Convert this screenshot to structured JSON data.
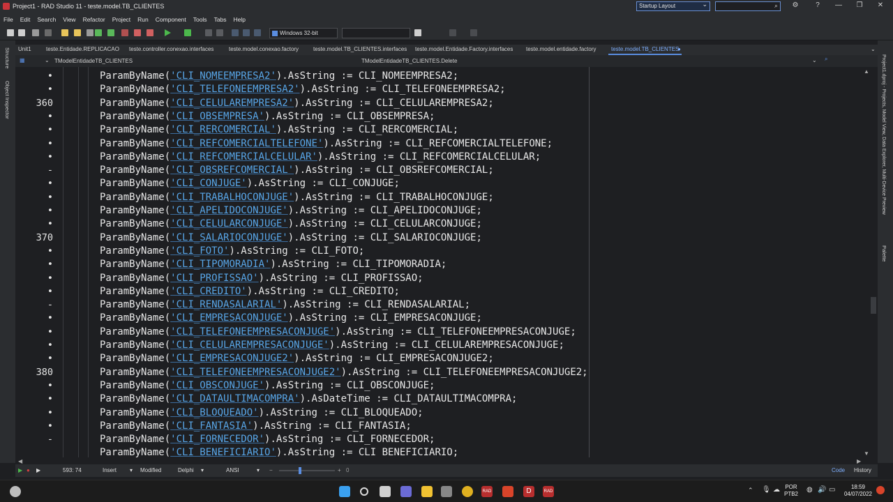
{
  "window": {
    "title": "Project1 - RAD Studio 11 - teste.model.TB_CLIENTES",
    "layout": "Startup Layout",
    "help": "?"
  },
  "menu": [
    "File",
    "Edit",
    "Search",
    "View",
    "Refactor",
    "Project",
    "Run",
    "Component",
    "Tools",
    "Tabs",
    "Help"
  ],
  "toolbar": {
    "platform": "Windows 32-bit",
    "config": ""
  },
  "left_rail": {
    "structure": "Structure",
    "object_inspector": "Object Inspector"
  },
  "right_rail": {
    "projects": "Project1.dproj - Projects, Model View, Data Explorer, Multi-Device Preview",
    "palette": "Palette"
  },
  "tabs": [
    "Unit1",
    "teste.Entidade.REPLICACAO",
    "teste.controller.conexao.interfaces",
    "teste.model.conexao.factory",
    "teste.model.TB_CLIENTES.interfaces",
    "teste.model.Entidade.Factory.interfaces",
    "teste.model.entidade.factory",
    "teste.model.TB_CLIENTES"
  ],
  "navbar": {
    "class": "TModelEntidadeTB_CLIENTES",
    "method": "TModelEntidadeTB_CLIENTES.Delete"
  },
  "editor": {
    "line_markers": [
      "•",
      "•",
      "360",
      "•",
      "•",
      "•",
      "•",
      "-",
      "•",
      "•",
      "•",
      "•",
      "370",
      "•",
      "•",
      "•",
      "•",
      "-",
      "•",
      "•",
      "•",
      "•",
      "380",
      "•",
      "•",
      "•",
      "•",
      "-"
    ],
    "lines": [
      {
        "pre": "ParamByName(",
        "str": "'CLI_NOMEEMPRESA2'",
        "post": ").AsString := CLI_NOMEEMPRESA2;"
      },
      {
        "pre": "ParamByName(",
        "str": "'CLI_TELEFONEEMPRESA2'",
        "post": ").AsString := CLI_TELEFONEEMPRESA2;"
      },
      {
        "pre": "ParamByName(",
        "str": "'CLI_CELULAREMPRESA2'",
        "post": ").AsString := CLI_CELULAREMPRESA2;"
      },
      {
        "pre": "ParamByName(",
        "str": "'CLI_OBSEMPRESA'",
        "post": ").AsString := CLI_OBSEMPRESA;"
      },
      {
        "pre": "ParamByName(",
        "str": "'CLI_RERCOMERCIAL'",
        "post": ").AsString := CLI_RERCOMERCIAL;"
      },
      {
        "pre": "ParamByName(",
        "str": "'CLI_REFCOMERCIALTELEFONE'",
        "post": ").AsString := CLI_REFCOMERCIALTELEFONE;"
      },
      {
        "pre": "ParamByName(",
        "str": "'CLI_REFCOMERCIALCELULAR'",
        "post": ").AsString := CLI_REFCOMERCIALCELULAR;"
      },
      {
        "pre": "ParamByName(",
        "str": "'CLI_OBSREFCOMERCIAL'",
        "post": ").AsString := CLI_OBSREFCOMERCIAL;"
      },
      {
        "pre": "ParamByName(",
        "str": "'CLI_CONJUGE'",
        "post": ").AsString := CLI_CONJUGE;"
      },
      {
        "pre": "ParamByName(",
        "str": "'CLI_TRABALHOCONJUGE'",
        "post": ").AsString := CLI_TRABALHOCONJUGE;"
      },
      {
        "pre": "ParamByName(",
        "str": "'CLI_APELIDOCONJUGE'",
        "post": ").AsString := CLI_APELIDOCONJUGE;"
      },
      {
        "pre": "ParamByName(",
        "str": "'CLI_CELULARCONJUGE'",
        "post": ").AsString := CLI_CELULARCONJUGE;"
      },
      {
        "pre": "ParamByName(",
        "str": "'CLI_SALARIOCONJUGE'",
        "post": ").AsString := CLI_SALARIOCONJUGE;"
      },
      {
        "pre": "ParamByName(",
        "str": "'CLI_FOTO'",
        "post": ").AsString := CLI_FOTO;"
      },
      {
        "pre": "ParamByName(",
        "str": "'CLI_TIPOMORADIA'",
        "post": ").AsString := CLI_TIPOMORADIA;"
      },
      {
        "pre": "ParamByName(",
        "str": "'CLI_PROFISSAO'",
        "post": ").AsString := CLI_PROFISSAO;"
      },
      {
        "pre": "ParamByName(",
        "str": "'CLI_CREDITO'",
        "post": ").AsString := CLI_CREDITO;"
      },
      {
        "pre": "ParamByName(",
        "str": "'CLI_RENDASALARIAL'",
        "post": ").AsString := CLI_RENDASALARIAL;"
      },
      {
        "pre": "ParamByName(",
        "str": "'CLI_EMPRESACONJUGE'",
        "post": ").AsString := CLI_EMPRESACONJUGE;"
      },
      {
        "pre": "ParamByName(",
        "str": "'CLI_TELEFONEEMPRESACONJUGE'",
        "post": ").AsString := CLI_TELEFONEEMPRESACONJUGE;"
      },
      {
        "pre": "ParamByName(",
        "str": "'CLI_CELULAREMPRESACONJUGE'",
        "post": ").AsString := CLI_CELULAREMPRESACONJUGE;"
      },
      {
        "pre": "ParamByName(",
        "str": "'CLI_EMPRESACONJUGE2'",
        "post": ").AsString := CLI_EMPRESACONJUGE2;"
      },
      {
        "pre": "ParamByName(",
        "str": "'CLI_TELEFONEEMPRESACONJUGE2'",
        "post": ").AsString := CLI_TELEFONEEMPRESACONJUGE2;"
      },
      {
        "pre": "ParamByName(",
        "str": "'CLI_OBSCONJUGE'",
        "post": ").AsString := CLI_OBSCONJUGE;"
      },
      {
        "pre": "ParamByName(",
        "str": "'CLI_DATAULTIMACOMPRA'",
        "post": ").AsDateTime := CLI_DATAULTIMACOMPRA;"
      },
      {
        "pre": "ParamByName(",
        "str": "'CLI_BLOQUEADO'",
        "post": ").AsString := CLI_BLOQUEADO;"
      },
      {
        "pre": "ParamByName(",
        "str": "'CLI_FANTASIA'",
        "post": ").AsString := CLI_FANTASIA;"
      },
      {
        "pre": "ParamByName(",
        "str": "'CLI_FORNECEDOR'",
        "post": ").AsString := CLI_FORNECEDOR;"
      },
      {
        "pre": "ParamByName(",
        "str": "'CLI_BENEFICIARIO'",
        "post": ").AsString := CLI_BENEFICIARIO;"
      }
    ]
  },
  "status": {
    "position": "593: 74",
    "mode": "Insert",
    "state": "Modified",
    "language": "Delphi",
    "encoding": "ANSI",
    "zoom": "0",
    "code_tab": "Code",
    "history_tab": "History"
  },
  "taskbar": {
    "lang1": "POR",
    "lang2": "PTB2",
    "time": "18:59",
    "date": "04/07/2022"
  }
}
